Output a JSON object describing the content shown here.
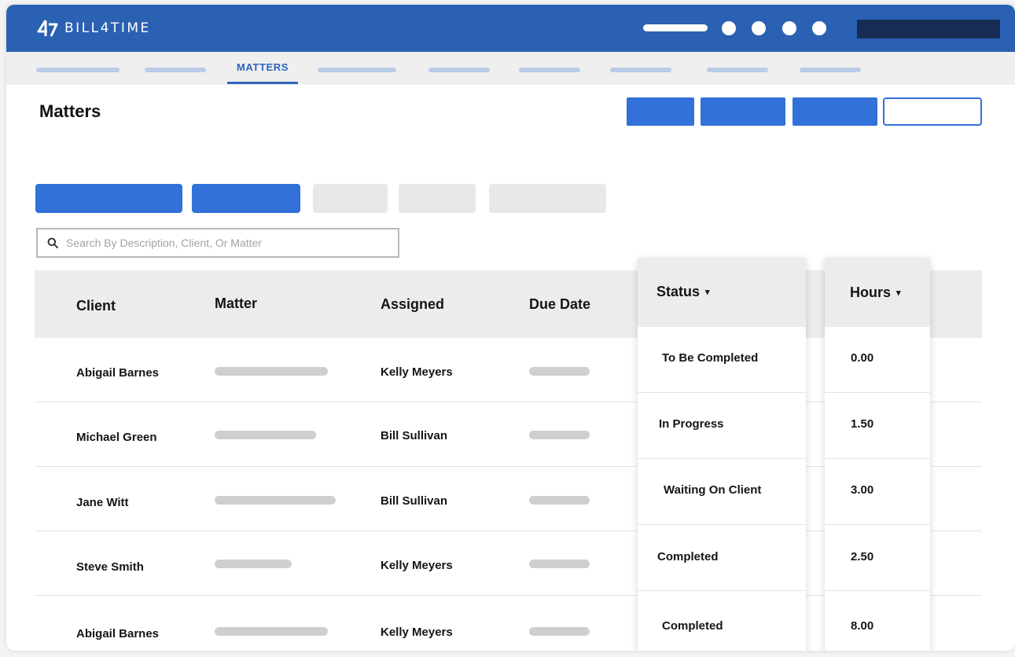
{
  "app": {
    "brand_name": "BILL4TIME",
    "brand_color": "#2a61b2",
    "accent_color": "#3271d8"
  },
  "nav": {
    "active_tab": "MATTERS"
  },
  "page": {
    "title": "Matters"
  },
  "search": {
    "placeholder": "Search By Description, Client, Or Matter",
    "value": ""
  },
  "table": {
    "columns": {
      "client": "Client",
      "matter": "Matter",
      "assigned": "Assigned",
      "due_date": "Due Date",
      "status": "Status",
      "hours": "Hours"
    },
    "sort_caret": "▾",
    "rows": [
      {
        "client": "Abigail Barnes",
        "assigned": "Kelly Meyers",
        "status": "To Be Completed",
        "hours": "0.00"
      },
      {
        "client": "Michael Green",
        "assigned": "Bill Sullivan",
        "status": "In Progress",
        "hours": "1.50"
      },
      {
        "client": "Jane Witt",
        "assigned": "Bill Sullivan",
        "status": "Waiting On Client",
        "hours": "3.00"
      },
      {
        "client": "Steve Smith",
        "assigned": "Kelly Meyers",
        "status": "Completed",
        "hours": "2.50"
      },
      {
        "client": "Abigail Barnes",
        "assigned": "Kelly Meyers",
        "status": "Completed",
        "hours": "8.00"
      }
    ]
  },
  "icons": {
    "logo": "bill4time-logo-icon",
    "search": "search-icon"
  }
}
